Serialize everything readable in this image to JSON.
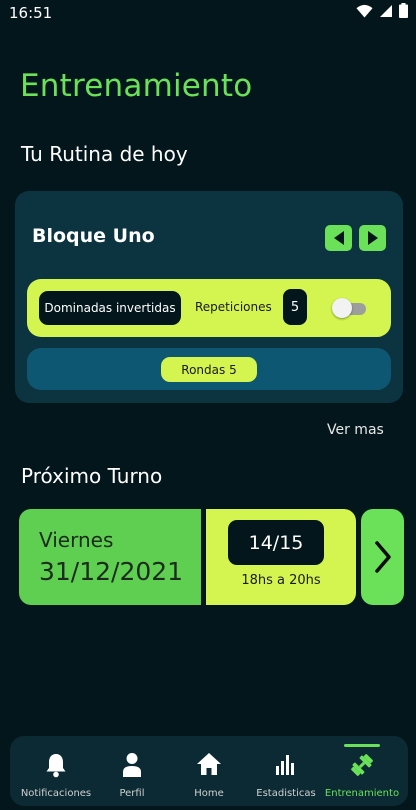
{
  "status_bar": {
    "time": "16:51"
  },
  "header": {
    "title": "Entrenamiento"
  },
  "routine": {
    "section_title": "Tu Rutina de hoy",
    "block_name": "Bloque Uno",
    "exercise": {
      "name": "Dominadas invertidas",
      "reps_label": "Repeticiones",
      "reps_value": "5",
      "toggle_on": false
    },
    "rounds_label": "Rondas 5",
    "see_more": "Ver mas"
  },
  "next_appointment": {
    "section_title": "Próximo Turno",
    "day": "Viernes",
    "date": "31/12/2021",
    "slots": "14/15",
    "hours": "18hs a 20hs"
  },
  "bottom_nav": {
    "items": [
      {
        "label": "Notificaciones",
        "icon": "bell-icon"
      },
      {
        "label": "Perfil",
        "icon": "person-icon"
      },
      {
        "label": "Home",
        "icon": "home-icon"
      },
      {
        "label": "Estadisticas",
        "icon": "bar-chart-icon"
      },
      {
        "label": "Entrenamiento",
        "icon": "dumbbell-icon",
        "active": true
      }
    ]
  },
  "colors": {
    "background": "#03161c",
    "accent_green": "#6ae159",
    "lime": "#d4f44f",
    "card": "#0b3440",
    "rounds_bar": "#0e5772"
  }
}
